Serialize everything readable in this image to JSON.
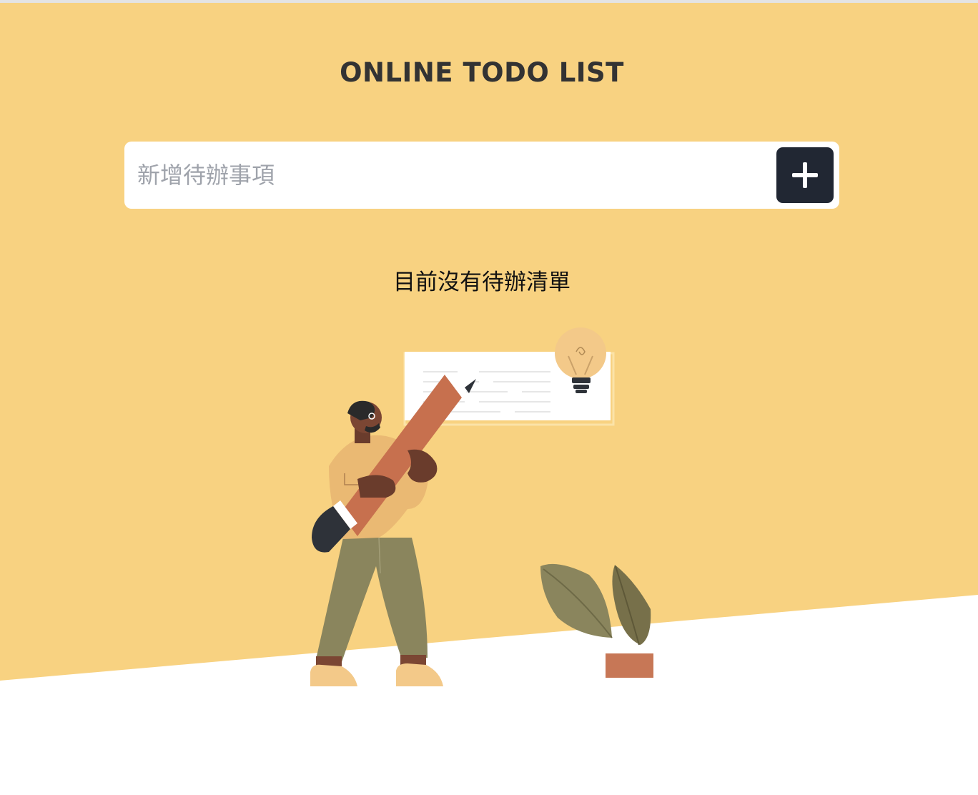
{
  "header": {
    "title": "ONLINE TODO LIST"
  },
  "todo_form": {
    "input_placeholder": "新增待辦事項",
    "input_value": "",
    "add_button_icon": "plus-icon"
  },
  "empty_state": {
    "message": "目前沒有待辦清單",
    "illustration": "person-holding-pencil-illustration"
  },
  "colors": {
    "background_accent": "#F8D281",
    "button_bg": "#212733",
    "title_text": "#333333",
    "placeholder_text": "#9FA3AB"
  }
}
